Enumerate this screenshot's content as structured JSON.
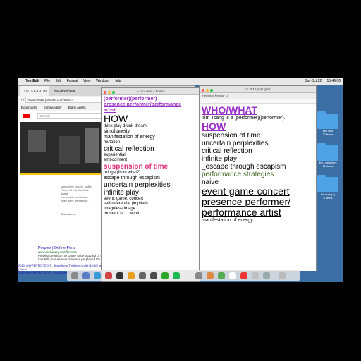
{
  "menubar": {
    "apple": "",
    "items": [
      "TextEdit",
      "File",
      "Edit",
      "Format",
      "View",
      "Window",
      "Help"
    ],
    "status": [
      "Sat Oct 22",
      "15:49:06"
    ]
  },
  "desktop": {
    "icons": [
      {
        "label": "ech well",
        "sub": "20 items"
      },
      {
        "label": "tim...gefactors",
        "sub": "11 items"
      },
      {
        "label": "tim tsang ()",
        "sub": "6 items"
      }
    ]
  },
  "browser": {
    "tabs": [
      "t i m t s a n g | Ri",
      "#433level |dea"
    ],
    "url": "https://www.youtube.com/watch?",
    "bookmarks": [
      "Bookmarks",
      "SimpleAdder",
      "Blank Aplets"
    ],
    "search_placeholder": "Search",
    "snippet_lines": [
      "synonyms: puzzle, baffle",
      "Prime, Ennui, Confuse",
      "dated",
      "complicate or confuse",
      "\"they wore perplexing\""
    ],
    "translation_label": "Translations",
    "result_title": "Perplex | Define Perpl",
    "result_url": "www.dictionary.com/browse",
    "result_desc": "Perplex definition, to cause to be puzzled or bewildered over what is not understood or certain;",
    "result_desc2": "mentally, nor abacus resource perplexed the",
    "footer_lines": [
      "2010: #HYPERTEXTEDIT - 'Algorithmic Thinking' (iv.de) [10:50] (and) [19:22-2016] #SurrerGather Recreated",
      "(Video)",
      "2010: #HYPERTEXTEDIT - 'Hui Citrines Failed Up' (Rhona Lamer Gel) [2:10-2016] (Video)"
    ]
  },
  "doc1": {
    "title": "~ cool deal ~ Edited",
    "lines": [
      {
        "t": "(performer)(performer)",
        "c": "purple s"
      },
      {
        "t": "presence performer/performance",
        "c": "purple s u"
      },
      {
        "t": "artist",
        "c": "purple s u"
      },
      {
        "t": "HOW",
        "c": "big"
      },
      {
        "t": "think play drunk dream",
        "c": "xs"
      },
      {
        "t": "simultaneity",
        "c": "s"
      },
      {
        "t": "manifestation of energy",
        "c": "s"
      },
      {
        "t": "mutation",
        "c": "xs"
      },
      {
        "t": "critical reflection",
        "c": "m"
      },
      {
        "t": "experiential",
        "c": "xs"
      },
      {
        "t": "embodiment",
        "c": "xs"
      },
      {
        "t": "suspension of time",
        "c": "pink m"
      },
      {
        "t": "refuge (from what?)",
        "c": "xs"
      },
      {
        "t": "escape through escapism",
        "c": "s"
      },
      {
        "t": "uncertain perplexities",
        "c": "m"
      },
      {
        "t": "infinite play",
        "c": "m"
      },
      {
        "t": "event, game, concert",
        "c": "xs"
      },
      {
        "t": "self-referential (implied)",
        "c": "xs"
      },
      {
        "t": "imageless image",
        "c": "xs"
      },
      {
        "t": "moment of ... within",
        "c": "xs"
      }
    ]
  },
  "doc2": {
    "title": "cv 2016 post grad",
    "toolbar": "Helvetica   Regular   18",
    "lines": [
      {
        "t": "WHO/WHAT",
        "c": "purple big u"
      },
      {
        "t": "Tim Tsang is a (performer)(performer).",
        "c": "s"
      },
      {
        "t": "HOW",
        "c": "purple big u"
      },
      {
        "t": "suspension of time",
        "c": "m"
      },
      {
        "t": "uncertain perplexities",
        "c": "m"
      },
      {
        "t": "critical reflection",
        "c": "m"
      },
      {
        "t": "infinite play",
        "c": "m"
      },
      {
        "t": "_escape through escapism",
        "c": "m"
      },
      {
        "t": "performance strategies",
        "c": "green m"
      },
      {
        "t": "naive",
        "c": "m"
      },
      {
        "t": " ",
        "c": "m"
      },
      {
        "t": "event-game-concert",
        "c": "big u"
      },
      {
        "t": " ",
        "c": "m"
      },
      {
        "t": "presence performer/",
        "c": "big u"
      },
      {
        "t": "performance artist",
        "c": "big u"
      },
      {
        "t": "manifestation of energy",
        "c": "s"
      }
    ]
  },
  "colors": {
    "accent_purple": "#9b30c9",
    "accent_pink": "#e0307a",
    "desktop": "#3a6ea5"
  }
}
